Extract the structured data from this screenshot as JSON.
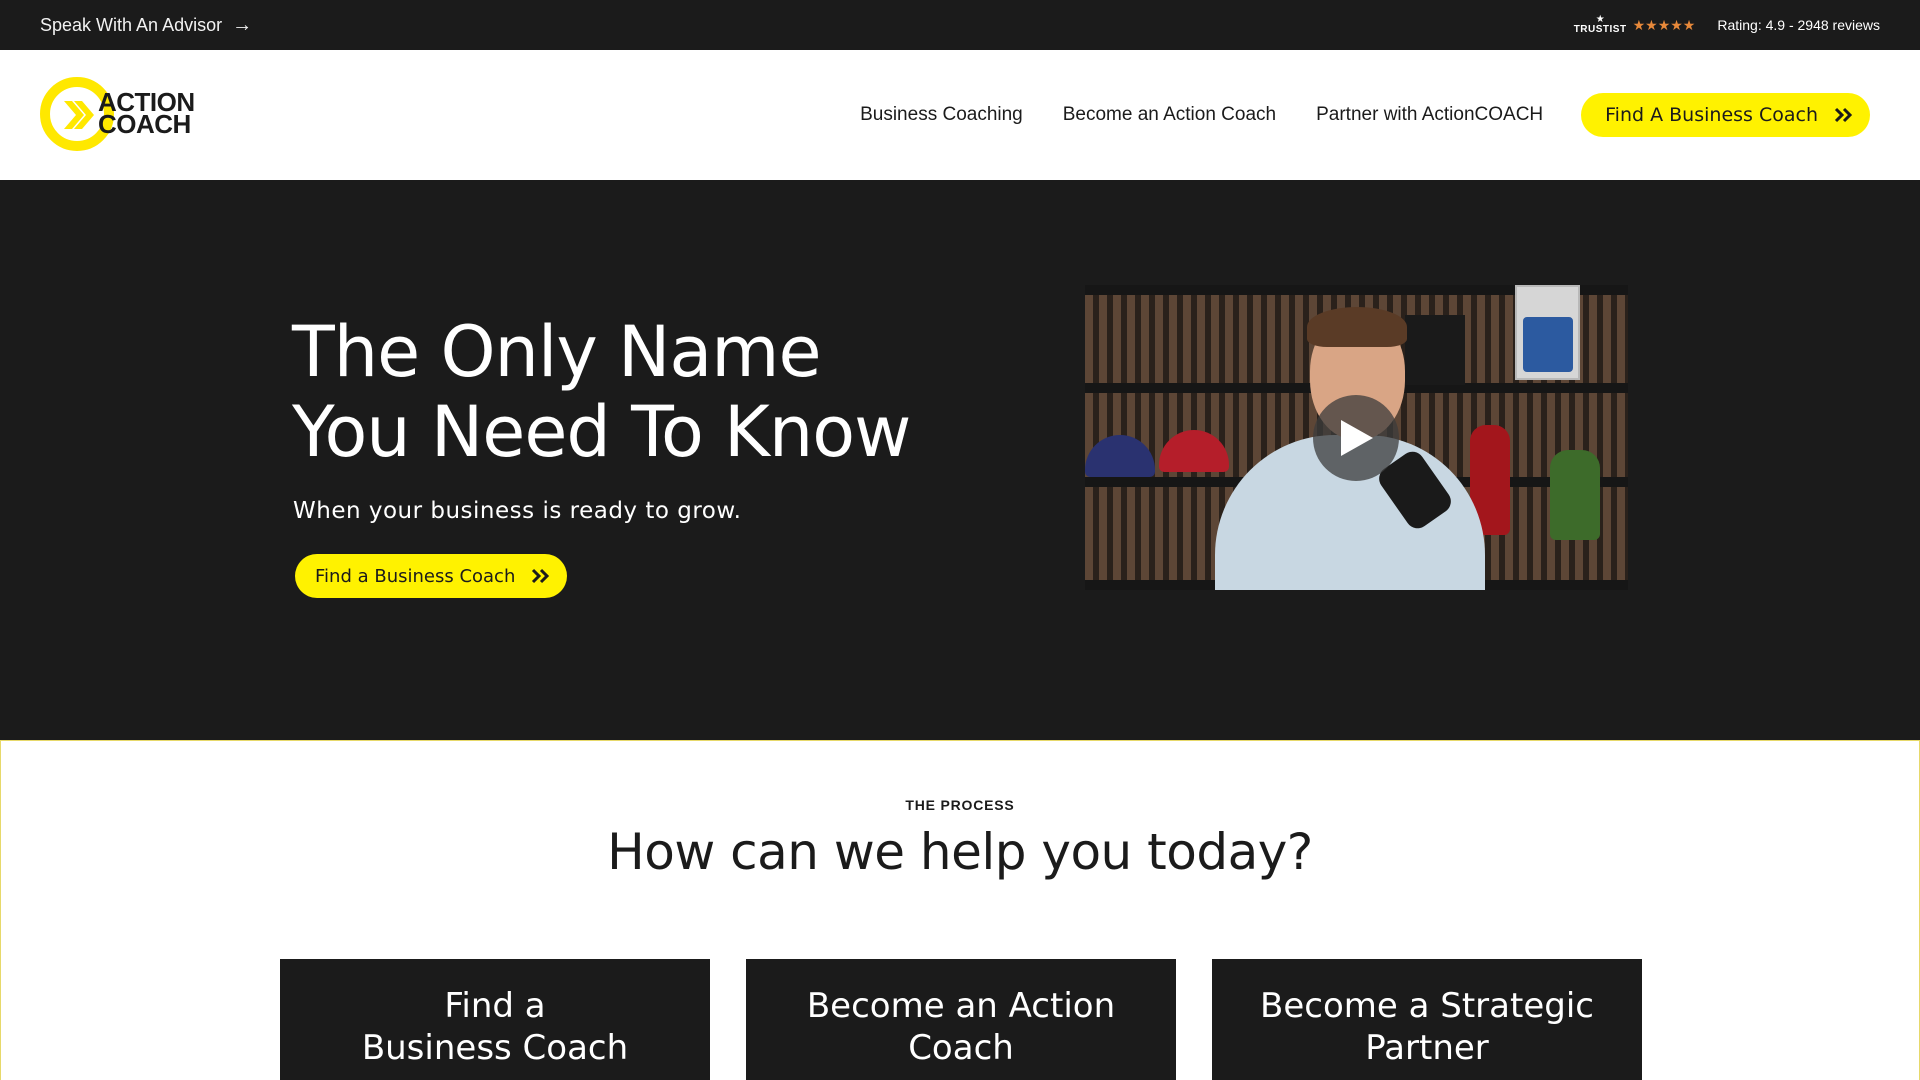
{
  "topbar": {
    "advisor_label": "Speak With An Advisor",
    "advisor_arrow": "→",
    "trust_brand": "TRUSTIST",
    "trust_stars": "★★★★★",
    "rating_text": "Rating: 4.9 - 2948 reviews"
  },
  "header": {
    "logo_text_line1": "ACTION",
    "logo_text_line2": "COACH",
    "nav": [
      {
        "label": "Business Coaching"
      },
      {
        "label": "Become an Action Coach"
      },
      {
        "label": "Partner with ActionCOACH"
      }
    ],
    "cta_label": "Find A Business Coach"
  },
  "hero": {
    "title_line1": "The Only Name",
    "title_line2": "You Need To Know",
    "subtitle": "When your business is ready to grow.",
    "cta_label": "Find a Business Coach"
  },
  "process": {
    "eyebrow": "THE PROCESS",
    "title": "How can we help you today?",
    "cards": [
      {
        "line1": "Find a",
        "line2": "Business Coach"
      },
      {
        "line1": "Become an Action",
        "line2": "Coach"
      },
      {
        "line1": "Become a Strategic",
        "line2": "Partner"
      }
    ]
  },
  "colors": {
    "brand_yellow": "#fff200",
    "dark": "#1b1b1b",
    "star_orange": "#e8893a"
  },
  "icons": {
    "advisor_arrow": "arrow-right-icon",
    "cta_chevrons": "double-chevron-right-icon",
    "video_play": "play-icon"
  }
}
